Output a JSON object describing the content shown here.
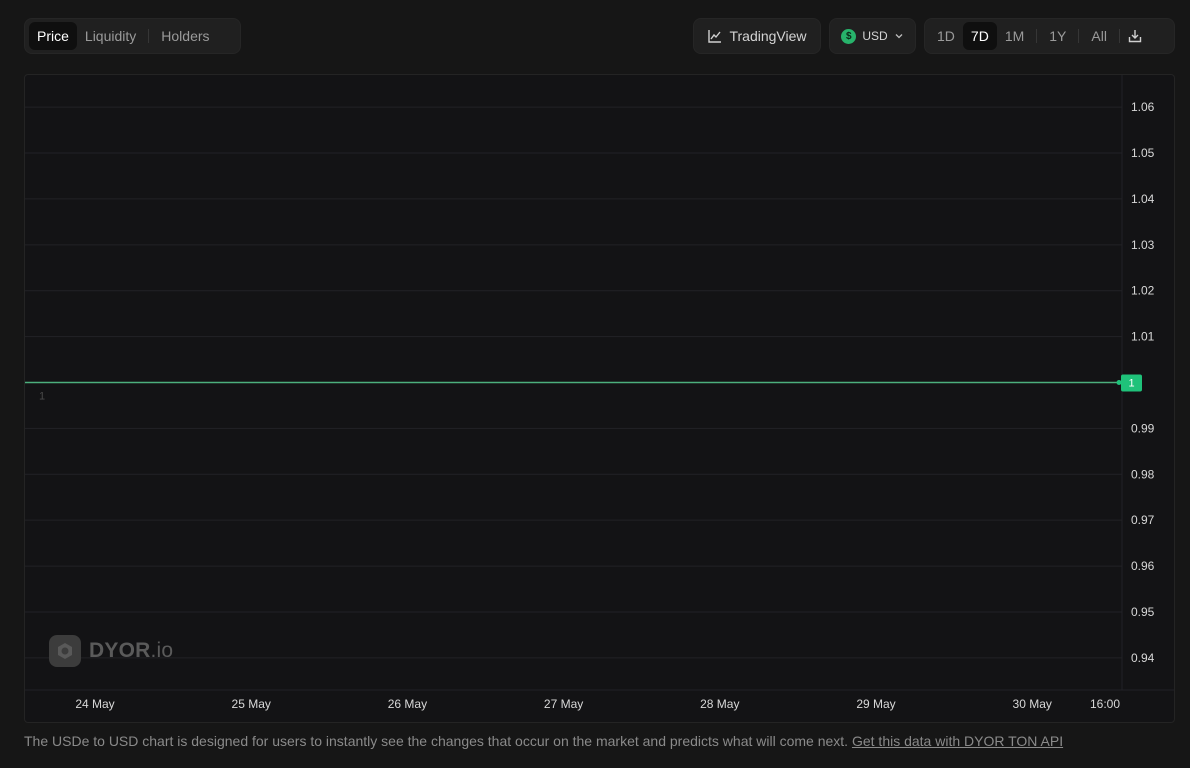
{
  "tabs": [
    {
      "label": "Price",
      "active": true
    },
    {
      "label": "Liquidity",
      "active": false
    },
    {
      "label": "Holders",
      "active": false
    }
  ],
  "tradingview_label": "TradingView",
  "currency": {
    "label": "USD",
    "coin_symbol": "$",
    "coin_color": "#27b36b"
  },
  "periods": [
    {
      "label": "1D",
      "active": false
    },
    {
      "label": "7D",
      "active": true
    },
    {
      "label": "1M",
      "active": false
    },
    {
      "label": "1Y",
      "active": false
    },
    {
      "label": "All",
      "active": false
    }
  ],
  "icons": {
    "tradingview": "line-chart-icon",
    "currency": "dollar-coin-icon",
    "dropdown": "chevron-down-icon",
    "download": "download-icon",
    "watermark": "dyor-logo-icon"
  },
  "watermark": {
    "brand": "DYOR",
    "suffix": ".io"
  },
  "colors": {
    "line": "#4caf7d",
    "price_tag": "#1fc27a",
    "grid": "#222226",
    "axis_text": "#d8d8d8"
  },
  "chart_data": {
    "type": "line",
    "x_tick_labels": [
      "24 May",
      "25 May",
      "26 May",
      "27 May",
      "28 May",
      "29 May",
      "30 May",
      "16:00"
    ],
    "y_tick_labels": [
      "1.06",
      "1.05",
      "1.04",
      "1.03",
      "1.02",
      "1.01",
      "1",
      "0.99",
      "0.98",
      "0.97",
      "0.96",
      "0.95",
      "0.94"
    ],
    "series": [
      {
        "values": [
          1,
          1,
          1,
          1,
          1,
          1,
          1,
          1
        ]
      }
    ],
    "ylim": [
      0.933,
      1.067
    ],
    "current_value_label": "1",
    "inline_label": "1",
    "grid": true,
    "y_axis_position": "right"
  },
  "footer": {
    "text": "The USDe to USD chart is designed for users to instantly see the changes that occur on the market and predicts what will come next.",
    "link_label": "Get this data with DYOR TON API"
  }
}
